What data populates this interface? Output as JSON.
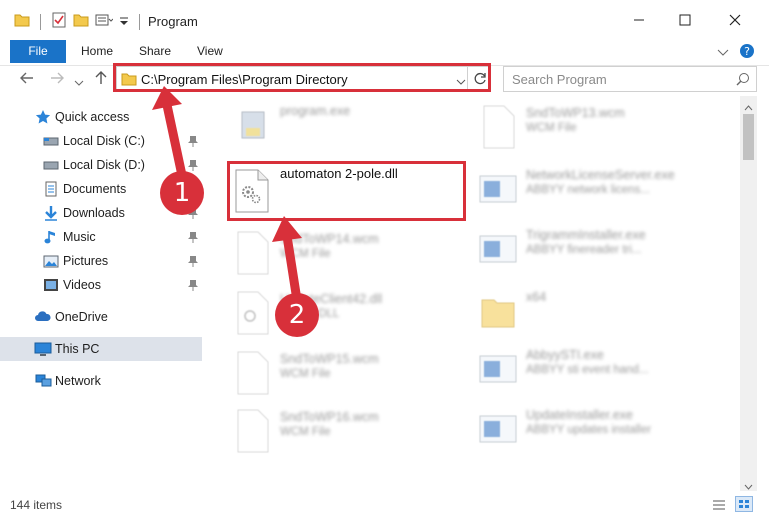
{
  "window": {
    "title": "Program"
  },
  "ribbon": {
    "file_tab": "File",
    "tabs": [
      "Home",
      "Share",
      "View"
    ]
  },
  "address": {
    "path": "C:\\Program Files\\Program Directory",
    "search_placeholder": "Search Program"
  },
  "nav": {
    "quick_access": "Quick access",
    "items": [
      {
        "label": "Local Disk (C:)",
        "icon": "drive-icon",
        "pinned": true
      },
      {
        "label": "Local Disk (D:)",
        "icon": "drive-icon",
        "pinned": true
      },
      {
        "label": "Documents",
        "icon": "documents-icon",
        "pinned": true
      },
      {
        "label": "Downloads",
        "icon": "downloads-icon",
        "pinned": true
      },
      {
        "label": "Music",
        "icon": "music-icon",
        "pinned": true
      },
      {
        "label": "Pictures",
        "icon": "pictures-icon",
        "pinned": true
      },
      {
        "label": "Videos",
        "icon": "videos-icon",
        "pinned": true
      }
    ],
    "onedrive": "OneDrive",
    "this_pc": "This PC",
    "network": "Network"
  },
  "files": {
    "left": [
      {
        "name": "program.exe",
        "sub": ""
      },
      {
        "name": "automaton 2-pole.dll",
        "sub": ""
      },
      {
        "name": "SndToWP14.wcm",
        "sub": "WCM File"
      },
      {
        "name": "UpdateClient42.dll",
        "sub": "Device DLL"
      },
      {
        "name": "SndToWP15.wcm",
        "sub": "WCM File"
      },
      {
        "name": "SndToWP16.wcm",
        "sub": "WCM File"
      }
    ],
    "right": [
      {
        "name": "SndToWP13.wcm",
        "sub": "WCM File"
      },
      {
        "name": "NetworkLicenseServer.exe",
        "sub": "ABBYY network licens..."
      },
      {
        "name": "TrigrammInstaller.exe",
        "sub": "ABBYY finereader tri..."
      },
      {
        "name": "x64",
        "sub": ""
      },
      {
        "name": "AbbyySTI.exe",
        "sub": "ABBYY sti event hand..."
      },
      {
        "name": "UpdateInstaller.exe",
        "sub": "ABBYY updates installer"
      }
    ]
  },
  "status": {
    "item_count": "144 items"
  },
  "callouts": {
    "step1": "1",
    "step2": "2"
  },
  "colors": {
    "accent": "#1a73c8",
    "highlight": "#d8303a"
  }
}
